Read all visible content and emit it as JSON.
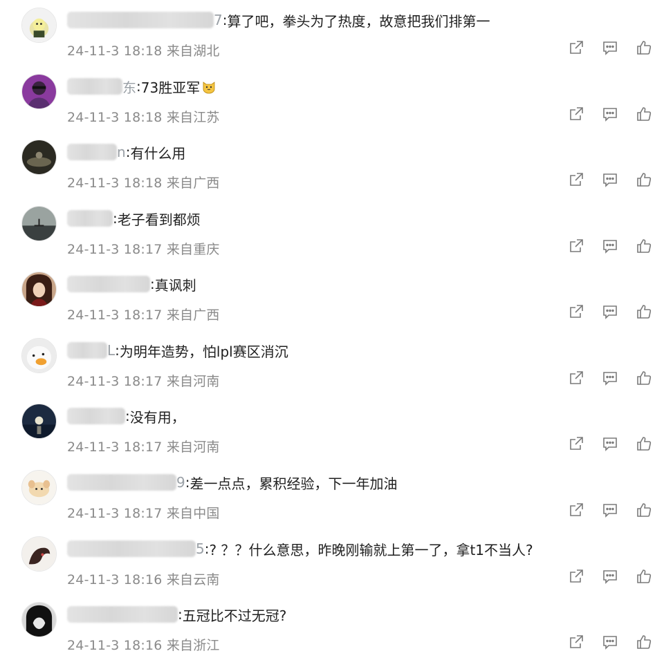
{
  "comments": [
    {
      "user_tail": "7",
      "text": "算了吧，拳头为了热度，故意把我们排第一",
      "date": "24-11-3 18:18",
      "location": "来自湖北"
    },
    {
      "user_tail": "东",
      "text": "73胜亚军",
      "date": "24-11-3 18:18",
      "location": "来自江苏"
    },
    {
      "user_tail": "n",
      "text": "有什么用",
      "date": "24-11-3 18:18",
      "location": "来自广西"
    },
    {
      "user_tail": "",
      "text": "老子看到都烦",
      "date": "24-11-3 18:17",
      "location": "来自重庆"
    },
    {
      "user_tail": "",
      "text": "真讽刺",
      "date": "24-11-3 18:17",
      "location": "来自广西"
    },
    {
      "user_tail": "L",
      "text": "为明年造势，怕lpl赛区消沉",
      "date": "24-11-3 18:17",
      "location": "来自河南"
    },
    {
      "user_tail": "",
      "text": "没有用，",
      "date": "24-11-3 18:17",
      "location": "来自河南"
    },
    {
      "user_tail": "9",
      "text": "差一点点，累积经验，下一年加油",
      "date": "24-11-3 18:17",
      "location": "来自中国"
    },
    {
      "user_tail": "5",
      "text": "? ？？什么意思，昨晚刚输就上第一了，拿t1不当人?",
      "date": "24-11-3 18:16",
      "location": "来自云南"
    },
    {
      "user_tail": "",
      "text": "五冠比不过无冠?",
      "date": "24-11-3 18:16",
      "location": "来自浙江"
    }
  ],
  "icons": {
    "forward": "share-icon",
    "reply": "comment-icon",
    "like": "thumbs-up-icon"
  },
  "colors": {
    "text": "#1f1f1f",
    "meta": "#8a8a8a",
    "icon": "#7a7a7a"
  }
}
